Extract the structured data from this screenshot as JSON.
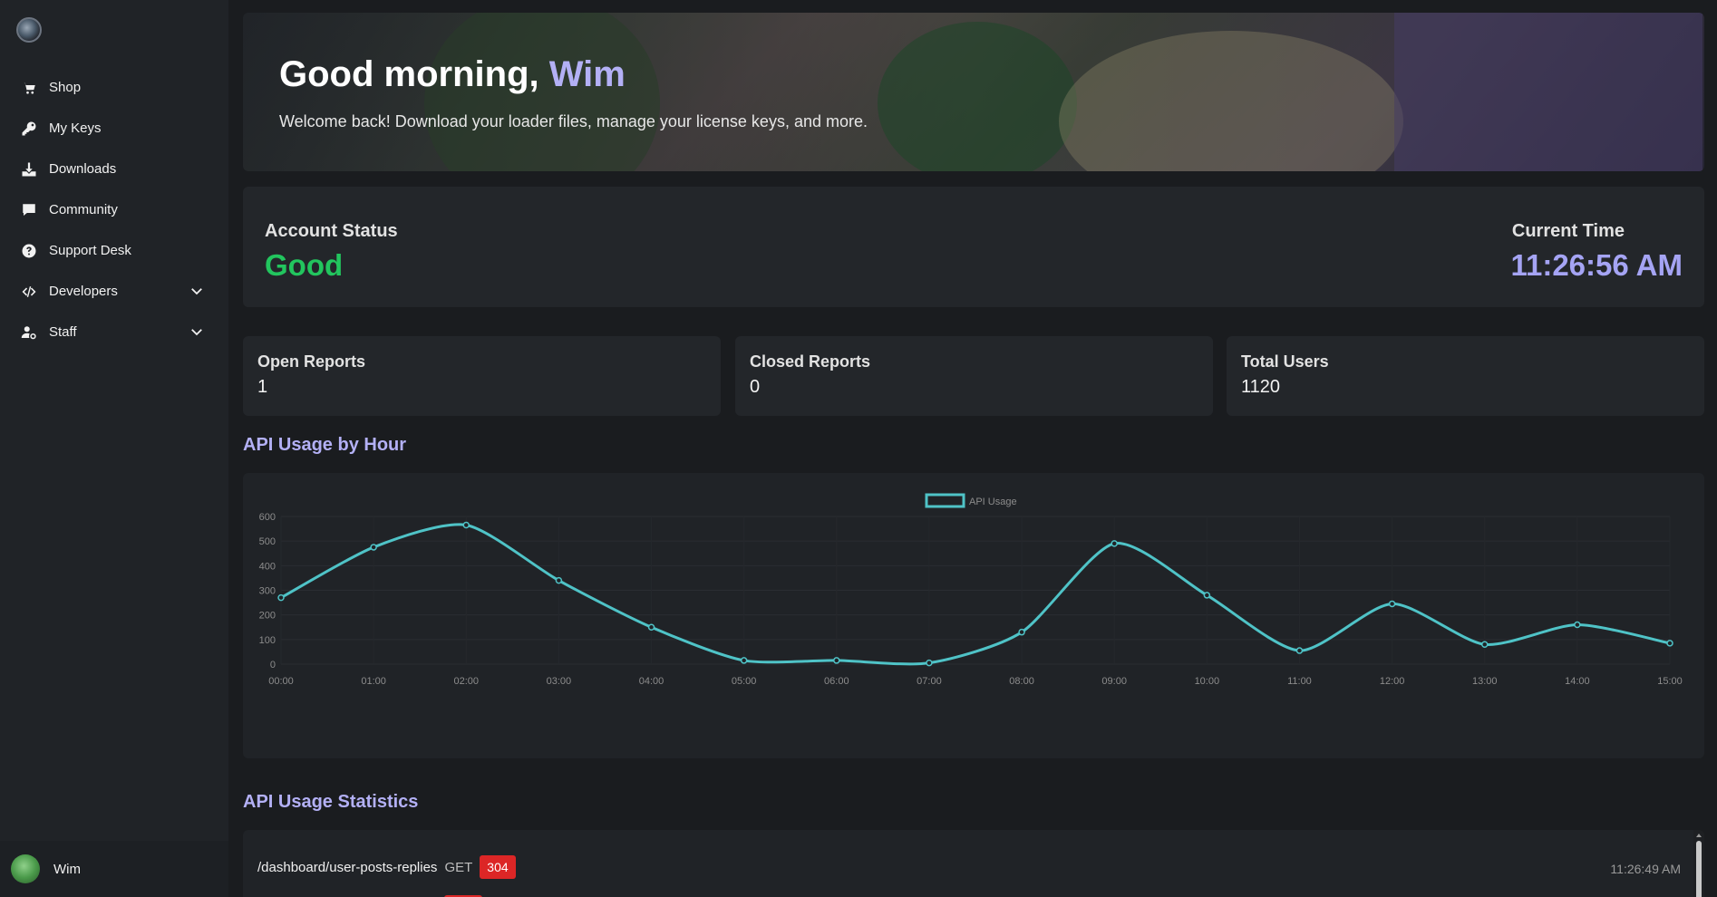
{
  "sidebar": {
    "items": [
      {
        "label": "Shop",
        "icon": "cart-icon"
      },
      {
        "label": "My Keys",
        "icon": "key-icon"
      },
      {
        "label": "Downloads",
        "icon": "download-icon"
      },
      {
        "label": "Community",
        "icon": "chat-icon"
      },
      {
        "label": "Support Desk",
        "icon": "help-circle-icon"
      },
      {
        "label": "Developers",
        "icon": "code-icon",
        "expandable": true
      },
      {
        "label": "Staff",
        "icon": "user-cog-icon",
        "expandable": true
      }
    ],
    "user": {
      "name": "Wim"
    }
  },
  "hero": {
    "greeting": "Good morning,",
    "name": "Wim",
    "subtitle": "Welcome back! Download your loader files, manage your license keys, and more."
  },
  "status": {
    "account_label": "Account Status",
    "account_value": "Good",
    "time_label": "Current Time",
    "time_value": "11:26:56 AM"
  },
  "stats": [
    {
      "label": "Open Reports",
      "value": "1"
    },
    {
      "label": "Closed Reports",
      "value": "0"
    },
    {
      "label": "Total Users",
      "value": "1120"
    }
  ],
  "sections": {
    "chart_title": "API Usage by Hour",
    "list_title": "API Usage Statistics"
  },
  "chart_data": {
    "type": "line",
    "title": "",
    "legend": [
      "API Usage"
    ],
    "legend_position": "top",
    "x": [
      "00:00",
      "01:00",
      "02:00",
      "03:00",
      "04:00",
      "05:00",
      "06:00",
      "07:00",
      "08:00",
      "09:00",
      "10:00",
      "11:00",
      "12:00",
      "13:00",
      "14:00",
      "15:00"
    ],
    "series": [
      {
        "name": "API Usage",
        "values": [
          270,
          475,
          565,
          340,
          150,
          15,
          15,
          5,
          130,
          490,
          280,
          55,
          245,
          80,
          160,
          85
        ]
      }
    ],
    "yticks": [
      "0",
      "100",
      "200",
      "300",
      "400",
      "500",
      "600"
    ],
    "ylim": [
      0,
      600
    ],
    "grid": true,
    "color": "#4fc3c7"
  },
  "api_stats": [
    {
      "endpoint": "/dashboard/user-posts-replies",
      "method": "GET",
      "status": "304",
      "time": "11:26:49 AM"
    }
  ],
  "colors": {
    "accent": "#b3b0f5",
    "good": "#22c55e",
    "error": "#dc2626",
    "line": "#4fc3c7"
  }
}
